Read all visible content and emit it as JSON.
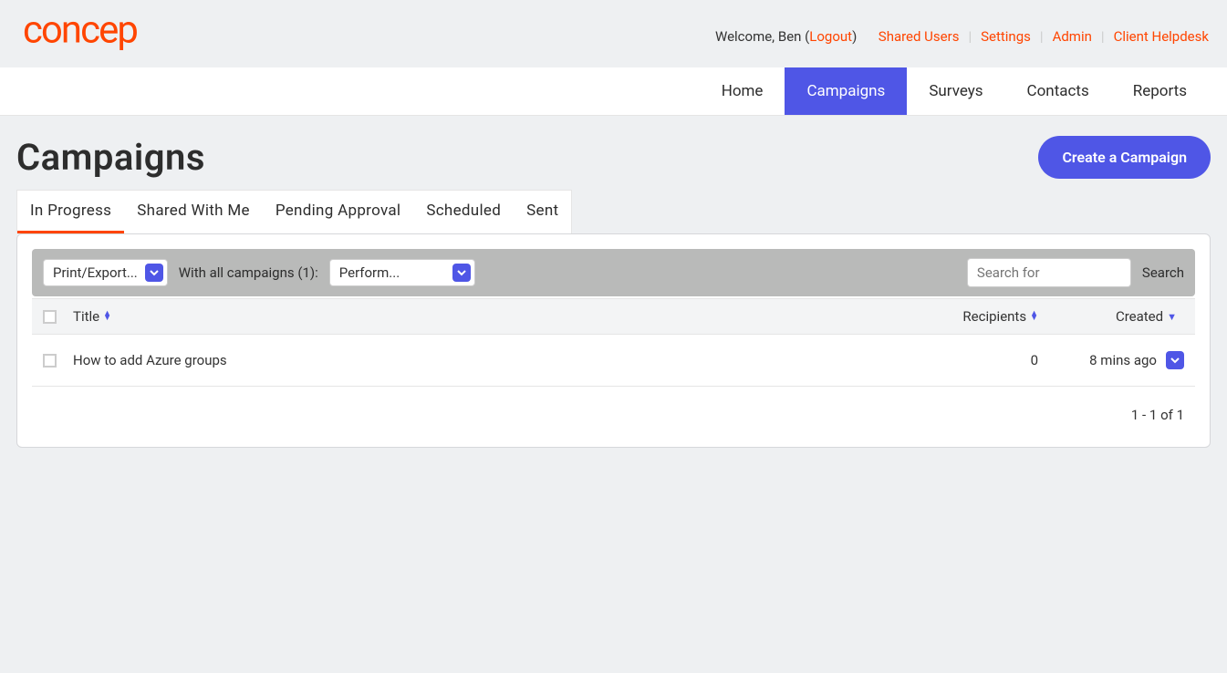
{
  "header": {
    "welcome_prefix": "Welcome, Ben (",
    "logout": "Logout",
    "welcome_suffix": ")",
    "links": [
      "Shared Users",
      "Settings",
      "Admin",
      "Client Helpdesk"
    ]
  },
  "nav": {
    "items": [
      "Home",
      "Campaigns",
      "Surveys",
      "Contacts",
      "Reports"
    ],
    "active": "Campaigns"
  },
  "page": {
    "title": "Campaigns",
    "create_button": "Create a Campaign"
  },
  "tabs": {
    "items": [
      "In Progress",
      "Shared With Me",
      "Pending Approval",
      "Scheduled",
      "Sent"
    ],
    "active": "In Progress"
  },
  "toolbar": {
    "print_export": "Print/Export...",
    "with_label": "With all campaigns (1):",
    "perform": "Perform...",
    "search_placeholder": "Search for",
    "search_button": "Search"
  },
  "table": {
    "columns": {
      "title": "Title",
      "recipients": "Recipients",
      "created": "Created"
    },
    "rows": [
      {
        "title": "How to add Azure groups",
        "recipients": "0",
        "created": "8 mins ago"
      }
    ],
    "pagination": "1 - 1 of 1"
  }
}
